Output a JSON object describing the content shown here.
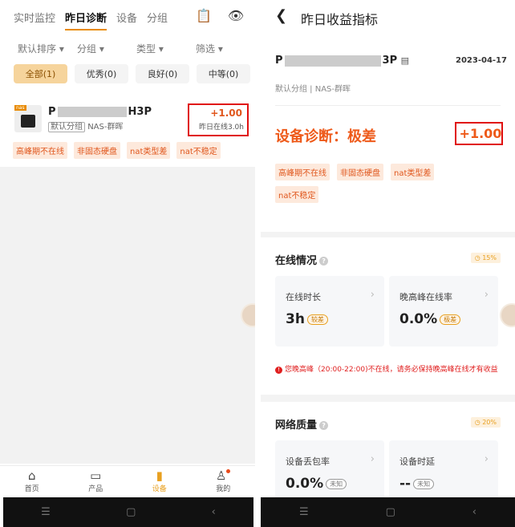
{
  "left": {
    "tabs": [
      "实时监控",
      "昨日诊断",
      "设备",
      "分组"
    ],
    "active_tab": "昨日诊断",
    "filters": [
      "默认排序 ▾",
      "分组 ▾",
      "类型 ▾",
      "筛选 ▾"
    ],
    "chips": [
      "全部(1)",
      "优秀(0)",
      "良好(0)",
      "中等(0)"
    ],
    "device": {
      "name_prefix": "P",
      "name_suffix": "H3P",
      "badge": "nas",
      "group": "默认分组",
      "type": "NAS-群晖",
      "amount": "+1.00",
      "online": "昨日在线3.0h"
    },
    "tags": [
      "高峰期不在线",
      "非固态硬盘",
      "nat类型差",
      "nat不稳定"
    ],
    "nav": [
      {
        "label": "首页",
        "icon": "⌂"
      },
      {
        "label": "产品",
        "icon": "▭"
      },
      {
        "label": "设备",
        "icon": "▮"
      },
      {
        "label": "我的",
        "icon": "♙"
      }
    ],
    "system_bar": [
      "☰",
      "▢",
      "‹"
    ]
  },
  "right": {
    "title": "昨日收益指标",
    "device_prefix": "P",
    "device_suffix": "3P",
    "date": "2023-04-17",
    "group_line": "默认分组 | NAS-群晖",
    "diagnosis": "设备诊断：极差",
    "amount": "+1.00",
    "tags": [
      "高峰期不在线",
      "非固态硬盘",
      "nat类型差",
      "nat不稳定"
    ],
    "online_section": {
      "title": "在线情况",
      "percent": "◷ 15%",
      "box1_label": "在线时长",
      "box1_value": "3h",
      "box1_badge": "较差",
      "box2_label": "晚高峰在线率",
      "box2_value": "0.0%",
      "box2_badge": "极差",
      "warning": "您晚高峰（20:00-22:00)不在线，请务必保持晚高峰在线才有收益"
    },
    "network_section": {
      "title": "网络质量",
      "percent": "◷ 20%",
      "box1_label": "设备丢包率",
      "box1_value": "0.0%",
      "box1_badge": "未知",
      "box2_label": "设备时延",
      "box2_value": "--",
      "box2_badge": "未知"
    },
    "system_bar": [
      "☰",
      "▢",
      "‹"
    ]
  }
}
